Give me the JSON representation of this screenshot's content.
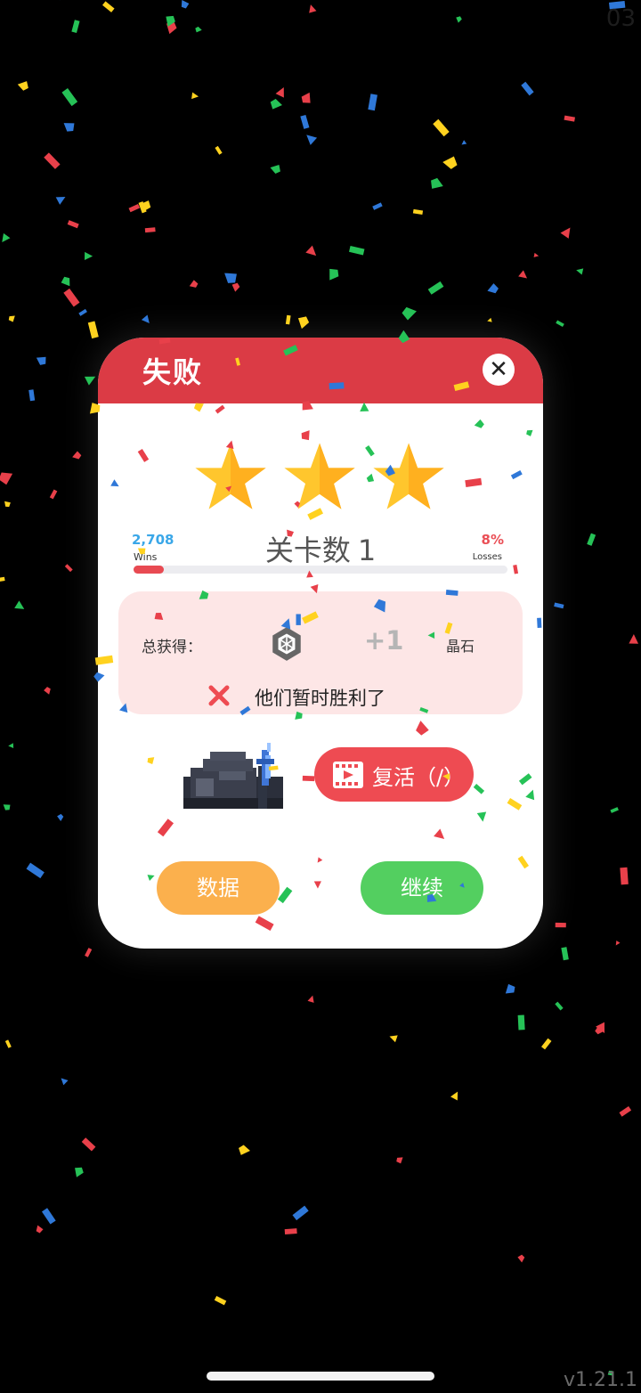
{
  "corner_number": "03",
  "version": "v1.21.1",
  "dialog": {
    "title": "失败",
    "close_icon": "close-icon",
    "stars": 3,
    "star_color": "#ffc62d",
    "header_color": "#db3b45",
    "stats": {
      "wins_value": "2,708",
      "wins_label": "Wins",
      "losses_value": "8%",
      "losses_label": "Losses",
      "loss_fraction": 0.08
    },
    "level": {
      "label": "关卡数",
      "value": "1"
    },
    "reward": {
      "label": "总获得：",
      "icon": "crystal-icon",
      "amount": "+1",
      "item": "晶石",
      "status_icon": "x-icon",
      "status_text": "他们暂时胜利了"
    },
    "revive": {
      "icon": "video-icon",
      "label": "复活（",
      "timer": "/",
      "label_end": "）"
    },
    "buttons": {
      "data": "数据",
      "continue": "继续"
    }
  },
  "colors": {
    "wins": "#3aa7e8",
    "losses": "#ea4f56",
    "revive": "#ee4b52",
    "data_button": "#fbb04d",
    "continue_button": "#53cf60"
  }
}
